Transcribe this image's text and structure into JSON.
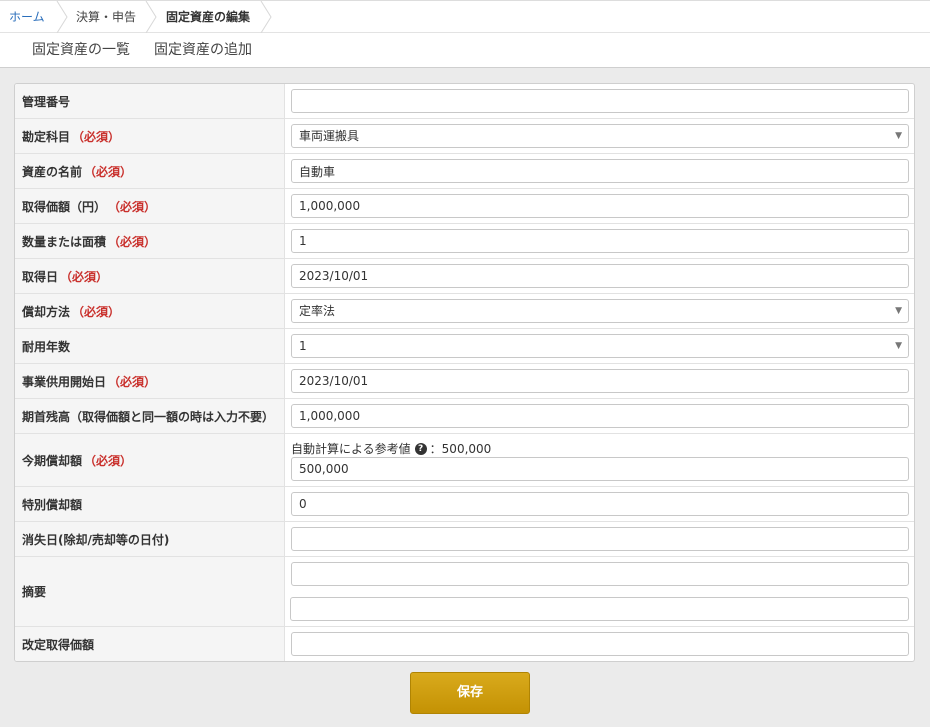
{
  "breadcrumb": {
    "home": "ホーム",
    "section": "決算・申告",
    "current": "固定資産の編集"
  },
  "tabs": {
    "list": "固定資産の一覧",
    "add": "固定資産の追加"
  },
  "form": {
    "required_mark": "（必須）",
    "management_number": {
      "label": "管理番号",
      "value": ""
    },
    "account": {
      "label": "勘定科目",
      "value": "車両運搬具"
    },
    "asset_name": {
      "label": "資産の名前",
      "value": "自動車"
    },
    "acquisition_price": {
      "label": "取得価額（円）",
      "value": "1,000,000"
    },
    "quantity": {
      "label": "数量または面積",
      "value": "1"
    },
    "acquisition_date": {
      "label": "取得日",
      "value": "2023/10/01"
    },
    "depreciation_method": {
      "label": "償却方法",
      "value": "定率法"
    },
    "useful_life": {
      "label": "耐用年数",
      "value": "1"
    },
    "service_start_date": {
      "label": "事業供用開始日",
      "value": "2023/10/01"
    },
    "opening_balance": {
      "label": "期首残高（取得価額と同一額の時は入力不要）",
      "value": "1,000,000"
    },
    "current_depreciation": {
      "label": "今期償却額",
      "hint_label": "自動計算による参考値",
      "hint_separator": "：",
      "hint_value": "500,000",
      "value": "500,000"
    },
    "special_depreciation": {
      "label": "特別償却額",
      "value": "0"
    },
    "disposal_date": {
      "label": "消失日(除却/売却等の日付)",
      "value": ""
    },
    "summary": {
      "label": "摘要",
      "value1": "",
      "value2": ""
    },
    "revised_price": {
      "label": "改定取得価額",
      "value": ""
    }
  },
  "save_button": "保存",
  "icons": {
    "select_caret": "caret-down-icon",
    "hint": "question-circle-icon",
    "breadcrumb_separator": "chevron-right-icon"
  }
}
